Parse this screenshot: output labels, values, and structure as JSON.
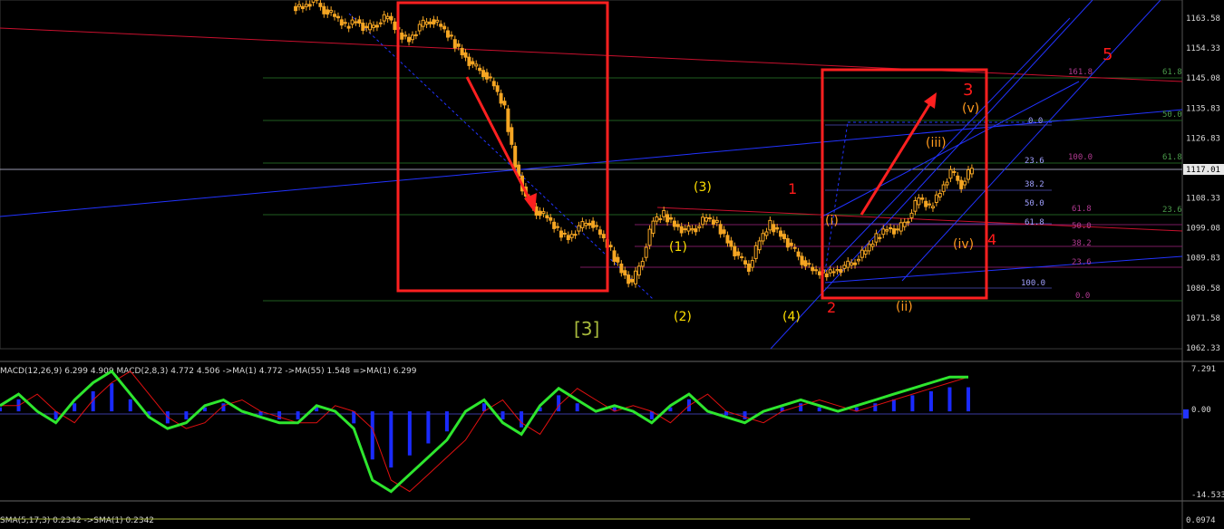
{
  "colors": {
    "background": "#000000",
    "candle": "#f5a623",
    "wave_label_yellow": "#ffdf00",
    "wave_label_red": "#ff1a1a",
    "wave_label_orange": "#ff9a1e",
    "wave_label_green": "#a7b93c",
    "annotation_box": "#ff2020",
    "trendline_blue": "#2233ff",
    "trendline_red": "#c8102e",
    "fib_green": "#1f5e1f",
    "fib_purple": "#7a1a60",
    "macd_main": "#2ee62e",
    "macd_signal": "#e01010",
    "macd_hist": "#1a2aff",
    "axis_text": "#d8d8d8"
  },
  "price_axis": {
    "labels": [
      "1163.58",
      "1154.33",
      "1145.08",
      "1135.83",
      "1126.83",
      "1117.01",
      "1108.33",
      "1099.08",
      "1089.83",
      "1080.58",
      "1071.58",
      "1062.33"
    ],
    "current_price": "1117.01"
  },
  "macd_axis": {
    "labels": [
      "7.291",
      "0.00",
      "-14.533"
    ]
  },
  "macd_header": "MACD(12,26,9) 6.299 4.909  MACD(2,8,3) 4.772 4.506  ->MA(1) 4.772  ->MA(55) 1.548  =>MA(1) 6.299",
  "bottom_header": "SMA(5,17,3) 0.2342  ->SMA(1) 0.2342",
  "bottom_axis_label": "0.0974",
  "wave_labels": {
    "bracket3": "[3]",
    "w1": "(1)",
    "w2": "(2)",
    "w3": "(3)",
    "w4": "(4)",
    "r1": "1",
    "r2": "2",
    "r3": "3",
    "r4": "4",
    "r5": "5",
    "ri": "(i)",
    "rii": "(ii)",
    "riii": "(iii)",
    "riv": "(iv)",
    "rv": "(v)"
  },
  "fib_labels": {
    "a_0": "0.0",
    "a_23": "23.6",
    "a_38": "38.2",
    "a_50": "50.0",
    "a_61": "61.8",
    "a_100": "100.0",
    "b_161": "161.8",
    "b_100": "100.0",
    "b_61": "61.8",
    "b_50": "50.0",
    "b_38": "38.2",
    "b_23": "23.6",
    "b_0": "0.0",
    "c_61": "61.8",
    "c_50": "50.0",
    "c_38": "38.2",
    "c_23": "23.6"
  },
  "chart_data": {
    "type": "candlestick",
    "title": "",
    "ylim": [
      1062.33,
      1168.0
    ],
    "price_series_approx": [
      1166,
      1168,
      1165,
      1163,
      1160,
      1162,
      1159,
      1161,
      1163,
      1158,
      1156,
      1160,
      1162,
      1160,
      1156,
      1152,
      1148,
      1146,
      1142,
      1135,
      1118,
      1108,
      1104,
      1102,
      1098,
      1096,
      1099,
      1101,
      1097,
      1092,
      1086,
      1082,
      1090,
      1101,
      1103,
      1100,
      1098,
      1099,
      1102,
      1100,
      1095,
      1090,
      1087,
      1095,
      1100,
      1097,
      1093,
      1089,
      1086,
      1085,
      1086,
      1087,
      1089,
      1092,
      1096,
      1099,
      1098,
      1102,
      1108,
      1105,
      1110,
      1116,
      1112,
      1117
    ],
    "macd_ylim": [
      -14.533,
      7.291
    ],
    "macd_series_approx": [
      1,
      3,
      0,
      -2,
      2,
      5,
      7,
      3,
      -1,
      -3,
      -2,
      1,
      2,
      0,
      -1,
      -2,
      -2,
      1,
      0,
      -3,
      -12,
      -14,
      -11,
      -8,
      -5,
      0,
      2,
      -2,
      -4,
      1,
      4,
      2,
      0,
      1,
      0,
      -2,
      1,
      3,
      0,
      -1,
      -2,
      0,
      1,
      2,
      1,
      0,
      1,
      2,
      3,
      4,
      5,
      6,
      6
    ]
  }
}
